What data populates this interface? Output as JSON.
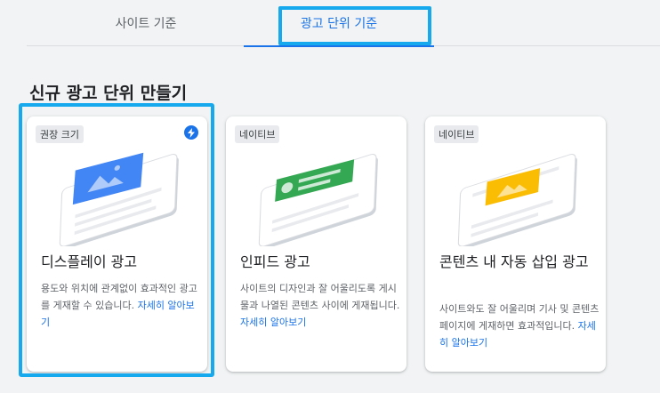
{
  "tabs": {
    "site_label": "사이트 기준",
    "unit_label": "광고 단위 기준"
  },
  "section_title": "신규 광고 단위 만들기",
  "cards": [
    {
      "chip": "권장 크기",
      "title": "디스플레이 광고",
      "desc": "용도와 위치에 관계없이 효과적인 광고를 게재할 수 있습니다.",
      "link": "자세히 알아보기",
      "accent": "#4285f4",
      "icon": "bolt-icon"
    },
    {
      "chip": "네이티브",
      "title": "인피드 광고",
      "desc": "사이트의 디자인과 잘 어울리도록 게시물과 나열된 콘텐츠 사이에 게재됩니다.",
      "link": "자세히 알아보기",
      "accent": "#34a853"
    },
    {
      "chip": "네이티브",
      "title": "콘텐츠 내 자동 삽입 광고",
      "desc": "사이트와도 잘 어울리며 기사 및 콘텐츠 페이지에 게재하면 효과적입니다.",
      "link": "자세히 알아보기",
      "accent": "#fbbc04"
    }
  ]
}
